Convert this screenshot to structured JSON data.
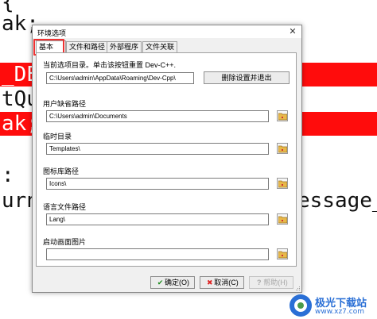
{
  "editor": {
    "lines": [
      {
        "text": "{",
        "highlight": false
      },
      {
        "text": "ak;",
        "highlight": false
      },
      {
        "text": "_DE",
        "highlight": true
      },
      {
        "text": "tQu",
        "highlight": false
      },
      {
        "text": "ak;",
        "highlight": true
      },
      {
        "text": ":",
        "highlight": false
      },
      {
        "text": "urn",
        "highlight": false
      },
      {
        "text": "essage_",
        "highlight": false
      }
    ],
    "highlight_color": "#ff0c0c"
  },
  "dialog": {
    "title": "环境选项",
    "close_glyph": "✕",
    "tabs": [
      {
        "label": "基本",
        "active": true
      },
      {
        "label": "文件和路径",
        "active": false
      },
      {
        "label": "外部程序",
        "active": false
      },
      {
        "label": "文件关联",
        "active": false
      }
    ],
    "panel": {
      "config_dir_label": "当前选项目录。单击该按钮重置 Dev-C++.",
      "config_dir_value": "C:\\Users\\admin\\AppData\\Roaming\\Dev-Cpp\\",
      "delete_button": "删除设置并退出",
      "user_path_label": "用户缺省路径",
      "user_path_value": "C:\\Users\\admin\\Documents",
      "temp_dir_label": "临时目录",
      "temp_dir_value": "Templates\\",
      "icon_lib_label": "图标库路径",
      "icon_lib_value": "Icons\\",
      "lang_path_label": "语言文件路径",
      "lang_path_value": "Lang\\",
      "splash_label": "启动画面图片",
      "splash_value": ""
    },
    "buttons": {
      "ok": {
        "icon": "✔",
        "label": "确定(O)"
      },
      "cancel": {
        "icon": "✖",
        "label": "取消(C)"
      },
      "help": {
        "icon": "?",
        "label": "帮助(H)"
      }
    }
  },
  "watermark": {
    "name": "极光下载站",
    "url": "www.xz7.com",
    "color": "#2a6fd6"
  }
}
